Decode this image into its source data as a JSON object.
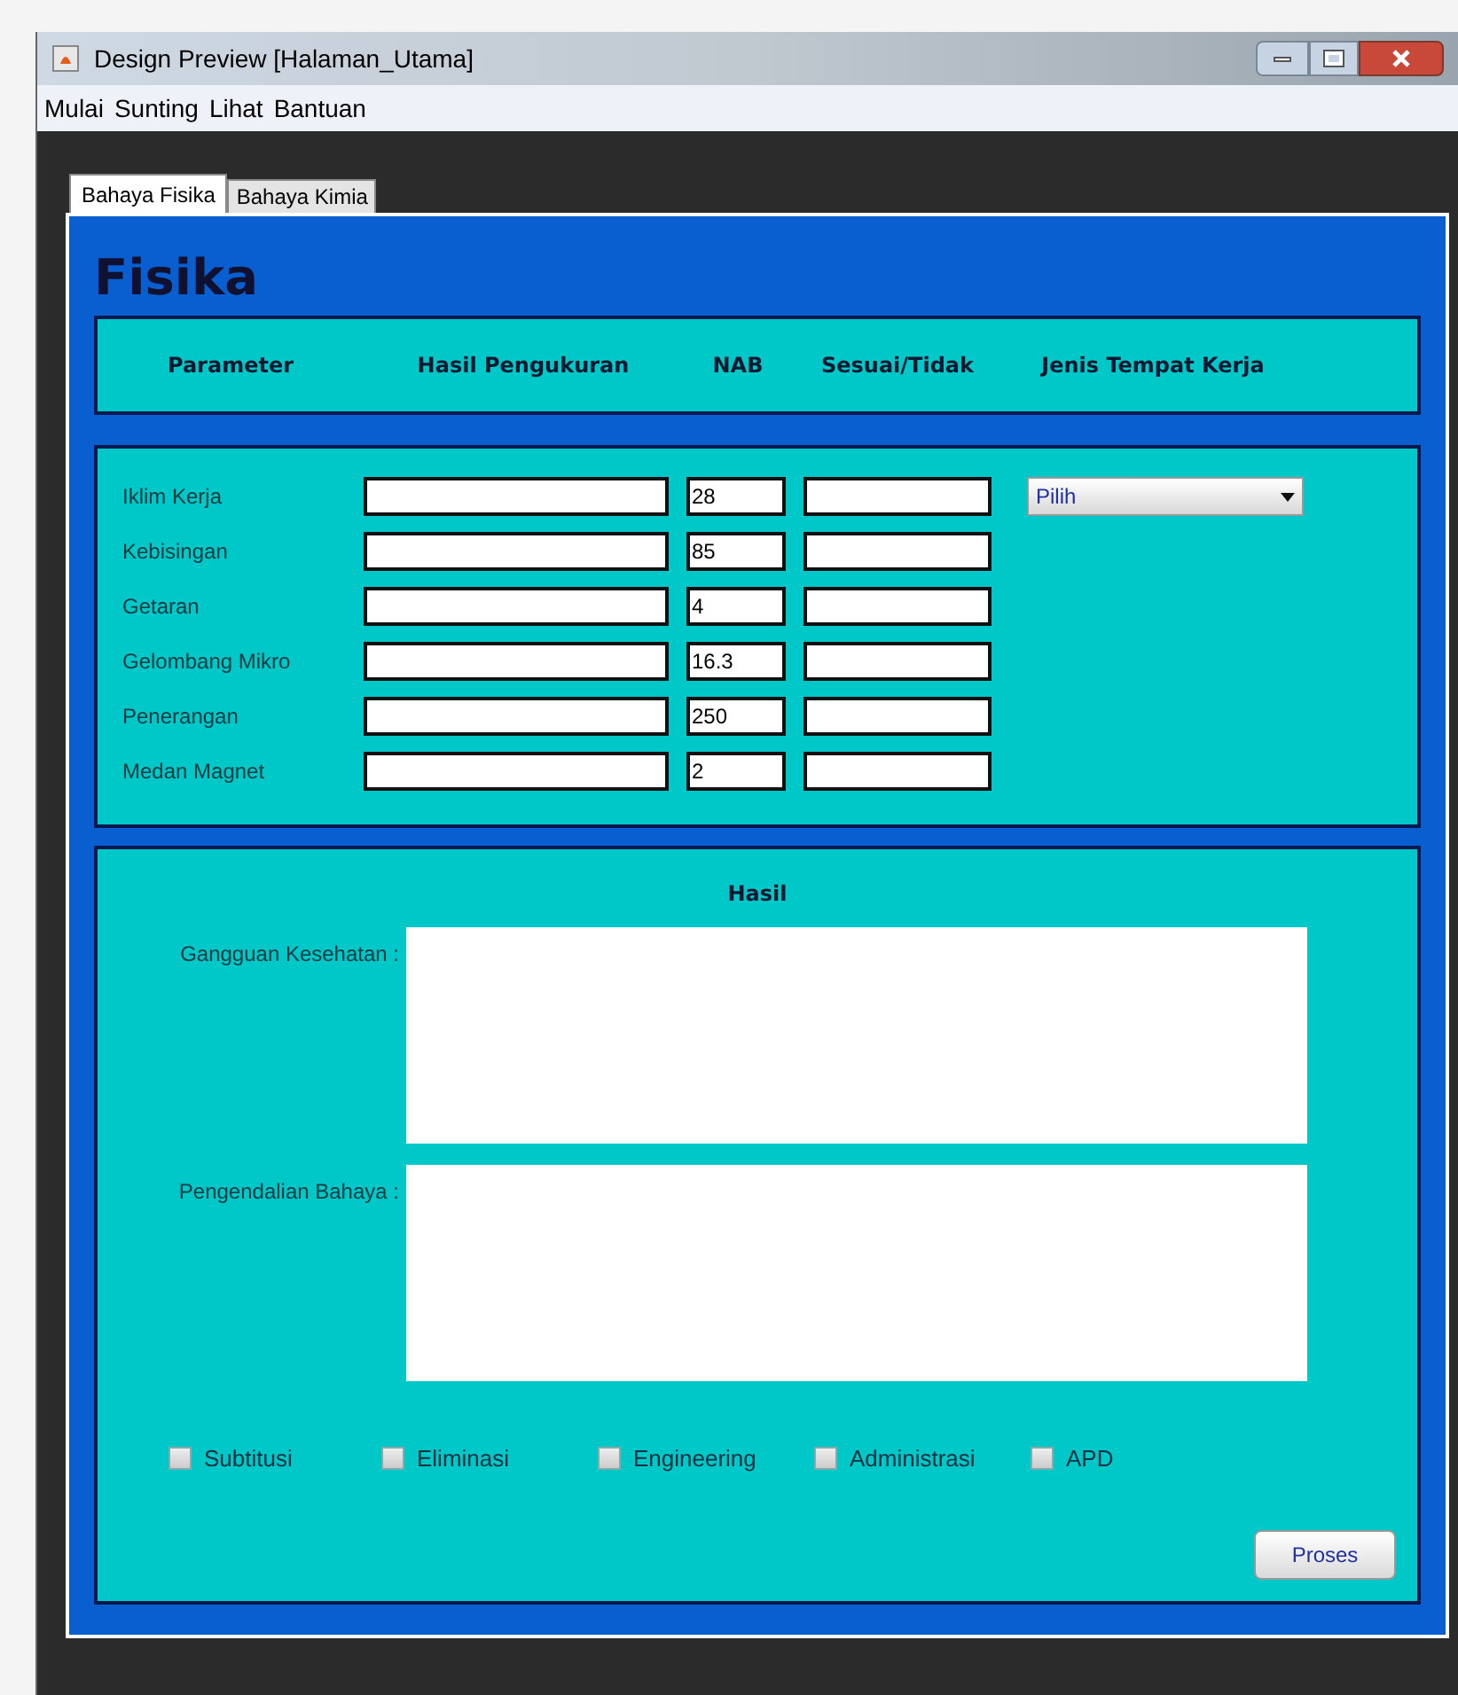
{
  "window": {
    "title": "Design Preview [Halaman_Utama]"
  },
  "menu": [
    "Mulai",
    "Sunting",
    "Lihat",
    "Bantuan"
  ],
  "tabs": [
    {
      "label": "Bahaya Fisika",
      "selected": true
    },
    {
      "label": "Bahaya Kimia",
      "selected": false
    }
  ],
  "heading": "Fisika",
  "columns": [
    "Parameter",
    "Hasil Pengukuran",
    "NAB",
    "Sesuai/Tidak",
    "Jenis Tempat Kerja"
  ],
  "rows": [
    {
      "label": "Iklim Kerja",
      "nab": "28"
    },
    {
      "label": "Kebisingan",
      "nab": "85"
    },
    {
      "label": "Getaran",
      "nab": "4"
    },
    {
      "label": "Gelombang Mikro",
      "nab": "16.3"
    },
    {
      "label": "Penerangan",
      "nab": "250"
    },
    {
      "label": "Medan Magnet",
      "nab": "2"
    }
  ],
  "workplace_dropdown": {
    "value": "Pilih"
  },
  "result": {
    "title": "Hasil",
    "areas": [
      "Gangguan Kesehatan :",
      "Pengendalian Bahaya :"
    ]
  },
  "controls": [
    {
      "label": "Subtitusi",
      "checked": false
    },
    {
      "label": "Eliminasi",
      "checked": false
    },
    {
      "label": "Engineering",
      "checked": false
    },
    {
      "label": "Administrasi",
      "checked": false
    },
    {
      "label": "APD",
      "checked": false
    }
  ],
  "button": "Proses"
}
